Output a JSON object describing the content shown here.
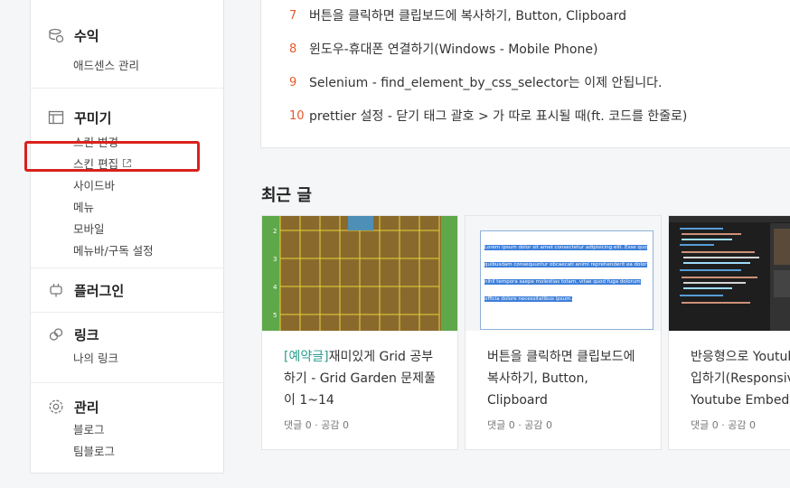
{
  "sidebar": {
    "revenue": {
      "title": "수익",
      "items": [
        "애드센스 관리"
      ]
    },
    "decorate": {
      "title": "꾸미기",
      "items": [
        "스킨 변경",
        "스킨 편집",
        "사이드바",
        "메뉴",
        "모바일",
        "메뉴바/구독 설정"
      ]
    },
    "plugin": {
      "title": "플러그인"
    },
    "link": {
      "title": "링크",
      "items": [
        "나의 링크"
      ]
    },
    "manage": {
      "title": "관리",
      "items": [
        "블로그",
        "팀블로그"
      ]
    }
  },
  "popular": [
    {
      "num": "7",
      "text": "버튼을 클릭하면 클립보드에 복사하기, Button, Clipboard"
    },
    {
      "num": "8",
      "text": "윈도우-휴대폰 연결하기(Windows - Mobile Phone)"
    },
    {
      "num": "9",
      "text": "Selenium - find_element_by_css_selector는 이제 안됩니다."
    },
    {
      "num": "10",
      "text": "prettier 설정 - 닫기 태그 괄호 > 가 따로 표시될 때(ft. 코드를 한줄로)"
    }
  ],
  "recent": {
    "title": "최근 글",
    "cards": [
      {
        "tag": "[예약글]",
        "title": "재미있게 Grid 공부하기 - Grid Garden 문제풀이 1~14",
        "meta": "댓글 0 · 공감 0"
      },
      {
        "tag": "",
        "title": "버튼을 클릭하면 클립보드에 복사하기, Button, Clipboard",
        "meta": "댓글 0 · 공감 0"
      },
      {
        "tag": "",
        "title": "반응형으로 Youtube 영상 삽입하기(Responsive Youtube Embed)",
        "meta": "댓글 0 · 공감 0"
      }
    ]
  },
  "thumb2_text": "Lorem ipsum dolor sit amet consectetur adipisicing elit. Esse quo quibusdam consequuntur obcaecati animi reprehenderit ea dolor nihil tempora saepe molestias totam, vitae quod fuga dolorum officia dolore necessitatibus ipsum.",
  "colors": {
    "accent_number": "#e55a2b",
    "highlight_box": "#d9221c",
    "tag": "#2a9d8f"
  }
}
